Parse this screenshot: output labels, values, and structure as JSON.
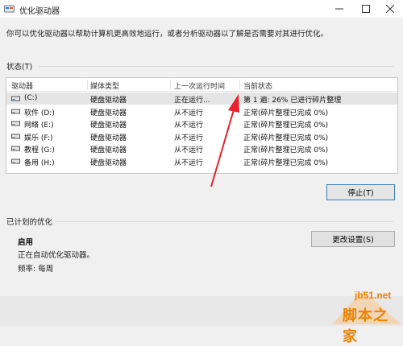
{
  "window": {
    "title": "优化驱动器"
  },
  "intro": "你可以优化驱动器以帮助计算机更高效地运行，或者分析驱动器以了解是否需要对其进行优化。",
  "status_section": {
    "label": "状态(T)"
  },
  "table": {
    "headers": [
      "驱动器",
      "媒体类型",
      "上一次运行时间",
      "当前状态"
    ],
    "rows": [
      {
        "drive": "(C:)",
        "media": "硬盘驱动器",
        "last_run": "正在运行...",
        "status": "第 1 遍: 26% 已进行碎片整理",
        "selected": true
      },
      {
        "drive": "软件 (D:)",
        "media": "硬盘驱动器",
        "last_run": "从不运行",
        "status": "正常(碎片整理已完成 0%)",
        "selected": false
      },
      {
        "drive": "网络 (E:)",
        "media": "硬盘驱动器",
        "last_run": "从不运行",
        "status": "正常(碎片整理已完成 0%)",
        "selected": false
      },
      {
        "drive": "娱乐 (F:)",
        "media": "硬盘驱动器",
        "last_run": "从不运行",
        "status": "正常(碎片整理已完成 0%)",
        "selected": false
      },
      {
        "drive": "教程 (G:)",
        "media": "硬盘驱动器",
        "last_run": "从不运行",
        "status": "正常(碎片整理已完成 0%)",
        "selected": false
      },
      {
        "drive": "备用 (H:)",
        "media": "硬盘驱动器",
        "last_run": "从不运行",
        "status": "正常(碎片整理已完成 0%)",
        "selected": false
      }
    ]
  },
  "buttons": {
    "stop": "停止(T)",
    "change_settings": "更改设置(S)"
  },
  "scheduled": {
    "label": "已计划的优化",
    "status": "启用",
    "description": "正在自动优化驱动器。",
    "frequency": "频率: 每周"
  },
  "watermark": {
    "url": "jb51.net",
    "name": "脚本之家"
  },
  "colors": {
    "arrow": "#e8212a",
    "accent_border": "#3c7fb1",
    "watermark": "#f08300"
  }
}
